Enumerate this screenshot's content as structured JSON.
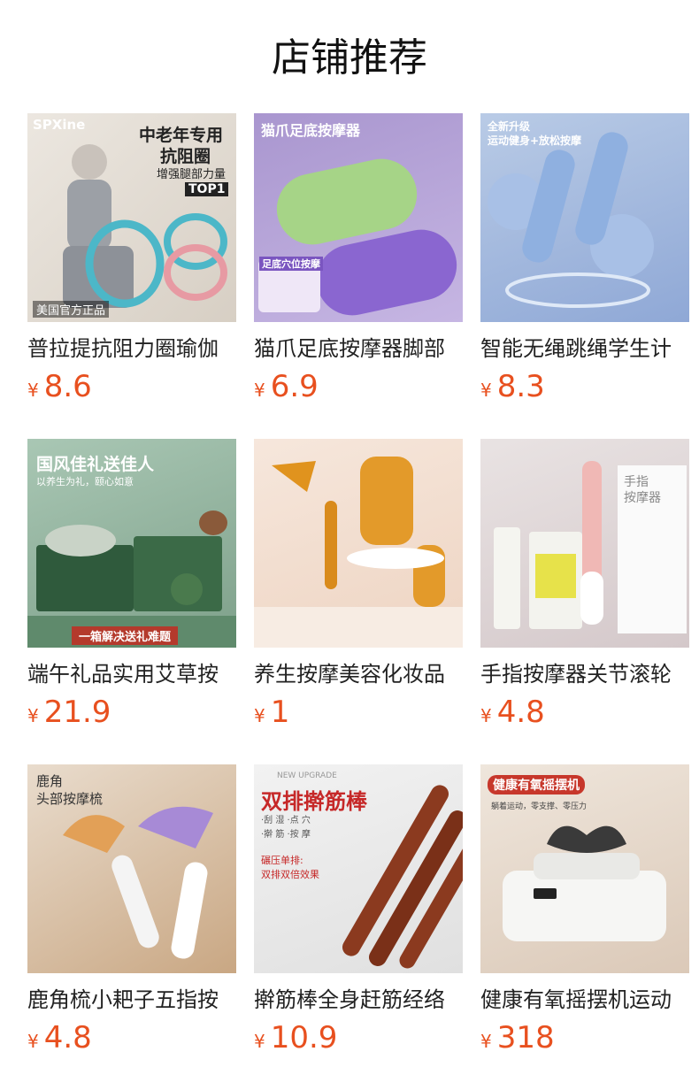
{
  "header": {
    "title": "店铺推荐"
  },
  "currency": "¥",
  "products": [
    {
      "name": "普拉提抗阻力圈瑜伽",
      "price": "8.6",
      "img_text": [
        "SPXine",
        "中老年专用",
        "抗阻圈",
        "增强腿部力量",
        "TOP1",
        "美国官方正品"
      ]
    },
    {
      "name": "猫爪足底按摩器脚部",
      "price": "6.9",
      "img_text": [
        "猫爪足底按摩器",
        "足底穴位按摩"
      ]
    },
    {
      "name": "智能无绳跳绳学生计",
      "price": "8.3",
      "img_text": [
        "全新升级",
        "运动健身+放松按摩"
      ]
    },
    {
      "name": "端午礼品实用艾草按",
      "price": "21.9",
      "img_text": [
        "国风佳礼送佳人",
        "以养生为礼，颐心如意",
        "一箱解决送礼难题"
      ]
    },
    {
      "name": "养生按摩美容化妆品",
      "price": "1",
      "img_text": []
    },
    {
      "name": "手指按摩器关节滚轮",
      "price": "4.8",
      "img_text": [
        "手指",
        "按摩器"
      ]
    },
    {
      "name": "鹿角梳小耙子五指按",
      "price": "4.8",
      "img_text": [
        "鹿角",
        "头部按摩梳"
      ]
    },
    {
      "name": "擀筋棒全身赶筋经络",
      "price": "10.9",
      "img_text": [
        "NEW UPGRADE",
        "双排擀筋棒",
        "·刮 湿 ·点 穴",
        "·擀 筋 ·按 摩",
        "碾压单排:",
        "双排双倍效果"
      ]
    },
    {
      "name": "健康有氧摇摆机运动",
      "price": "318",
      "img_text": [
        "健康有氧摇摆机",
        "躺着运动，零支撑、零压力"
      ]
    }
  ]
}
